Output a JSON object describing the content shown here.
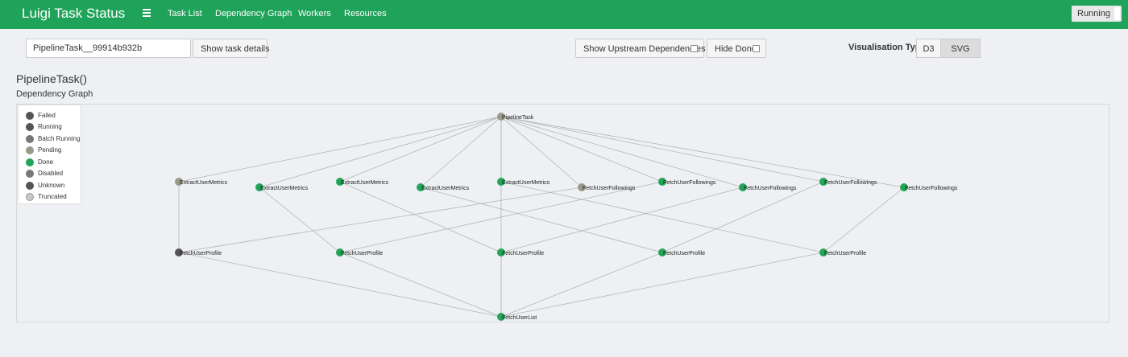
{
  "navbar": {
    "brand": "Luigi Task Status",
    "menu_icon": "hamburger-icon",
    "links": [
      "Task List",
      "Dependency Graph",
      "Workers",
      "Resources"
    ],
    "status": "Running"
  },
  "toolbar": {
    "task_input_value": "PipelineTask__99914b932b",
    "show_details_label": "Show task details",
    "upstream_label": "Show Upstream Dependencies",
    "hide_done_label": "Hide Done",
    "vis_type_label": "Visualisation Type",
    "vis_options": [
      "D3",
      "SVG"
    ],
    "vis_selected": "SVG"
  },
  "page": {
    "title": "PipelineTask()",
    "subtitle": "Dependency Graph"
  },
  "legend": [
    {
      "label": "Failed",
      "color": "#555555"
    },
    {
      "label": "Running",
      "color": "#555555"
    },
    {
      "label": "Batch Running",
      "color": "#777777"
    },
    {
      "label": "Pending",
      "color": "#9a9a8a"
    },
    {
      "label": "Done",
      "color": "#22a459"
    },
    {
      "label": "Disabled",
      "color": "#777777"
    },
    {
      "label": "Unknown",
      "color": "#555555"
    },
    {
      "label": "Truncated",
      "color": "#c8c8c8"
    }
  ],
  "colors": {
    "accent": "#1fa35a",
    "done": "#22a459",
    "pending": "#9a9a8a",
    "failed": "#555555",
    "edge": "#b5b5b5"
  },
  "graph": {
    "nodes": [
      {
        "label": "PipelineTask",
        "status": "pending"
      },
      {
        "label": "ExtractUserMetrics",
        "status": "pending"
      },
      {
        "label": "ExtractUserMetrics",
        "status": "done"
      },
      {
        "label": "ExtractUserMetrics",
        "status": "done"
      },
      {
        "label": "ExtractUserMetrics",
        "status": "done"
      },
      {
        "label": "ExtractUserMetrics",
        "status": "done"
      },
      {
        "label": "FetchUserFollowings",
        "status": "pending"
      },
      {
        "label": "FetchUserFollowings",
        "status": "done"
      },
      {
        "label": "FetchUserFollowings",
        "status": "done"
      },
      {
        "label": "FetchUserFollowings",
        "status": "done"
      },
      {
        "label": "FetchUserFollowings",
        "status": "done"
      },
      {
        "label": "FetchUserProfile",
        "status": "failed"
      },
      {
        "label": "FetchUserProfile",
        "status": "done"
      },
      {
        "label": "FetchUserProfile",
        "status": "done"
      },
      {
        "label": "FetchUserProfile",
        "status": "done"
      },
      {
        "label": "FetchUserProfile",
        "status": "done"
      },
      {
        "label": "FetchUserList",
        "status": "done"
      }
    ],
    "edges": [
      [
        0,
        1
      ],
      [
        0,
        2
      ],
      [
        0,
        3
      ],
      [
        0,
        4
      ],
      [
        0,
        5
      ],
      [
        0,
        6
      ],
      [
        0,
        7
      ],
      [
        0,
        8
      ],
      [
        0,
        9
      ],
      [
        0,
        10
      ],
      [
        0,
        16
      ],
      [
        1,
        11
      ],
      [
        2,
        12
      ],
      [
        3,
        13
      ],
      [
        4,
        14
      ],
      [
        5,
        15
      ],
      [
        6,
        11
      ],
      [
        7,
        12
      ],
      [
        8,
        13
      ],
      [
        9,
        14
      ],
      [
        10,
        15
      ],
      [
        11,
        16
      ],
      [
        12,
        16
      ],
      [
        13,
        16
      ],
      [
        14,
        16
      ],
      [
        15,
        16
      ]
    ]
  }
}
